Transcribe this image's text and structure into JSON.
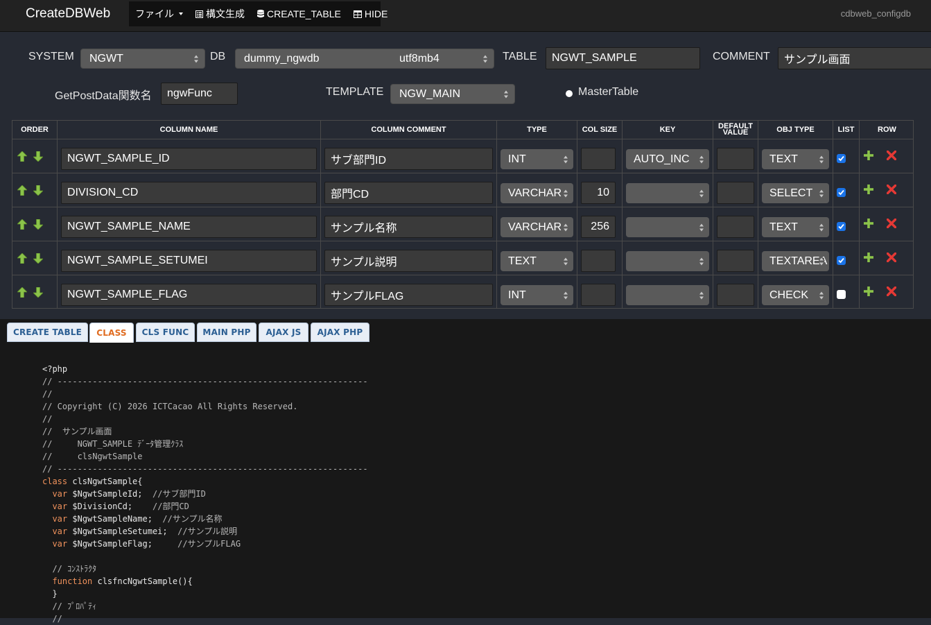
{
  "navbar": {
    "brand": "CreateDBWeb",
    "menu": {
      "file": "ファイル",
      "syntax": "構文生成",
      "create_table": "CREATE_TABLE",
      "hide": "HIDE"
    },
    "config_name": "cdbweb_configdb"
  },
  "form": {
    "system_label": "SYSTEM",
    "system_value": "NGWT",
    "db_label": "DB",
    "db_name": "dummy_ngwdb",
    "db_charset": "utf8mb4",
    "table_label": "TABLE",
    "table_value": "NGWT_SAMPLE",
    "comment_label": "COMMENT",
    "comment_value": "サンプル画面",
    "getpost_label": "GetPostData関数名",
    "getpost_value": "ngwFunc",
    "template_label": "TEMPLATE",
    "template_value": "NGW_MAIN",
    "master_table_label": "MasterTable"
  },
  "columns_table": {
    "headers": {
      "order": "ORDER",
      "column_name": "COLUMN NAME",
      "column_comment": "COLUMN COMMENT",
      "type": "TYPE",
      "col_size": "COL SIZE",
      "key": "KEY",
      "default_value_1": "DEFAULT",
      "default_value_2": "VALUE",
      "obj_type": "OBJ TYPE",
      "list": "LIST",
      "row": "ROW"
    },
    "rows": [
      {
        "name": "NGWT_SAMPLE_ID",
        "comment": "サブ部門ID",
        "type": "INT",
        "size": "",
        "key": "AUTO_INC",
        "default": "",
        "obj_type": "TEXT",
        "list": true
      },
      {
        "name": "DIVISION_CD",
        "comment": "部門CD",
        "type": "VARCHAR",
        "size": "10",
        "key": "",
        "default": "",
        "obj_type": "SELECT",
        "list": true
      },
      {
        "name": "NGWT_SAMPLE_NAME",
        "comment": "サンプル名称",
        "type": "VARCHAR",
        "size": "256",
        "key": "",
        "default": "",
        "obj_type": "TEXT",
        "list": true
      },
      {
        "name": "NGWT_SAMPLE_SETUMEI",
        "comment": "サンプル説明",
        "type": "TEXT",
        "size": "",
        "key": "",
        "default": "",
        "obj_type": "TEXTAREA",
        "list": true
      },
      {
        "name": "NGWT_SAMPLE_FLAG",
        "comment": "サンプルFLAG",
        "type": "INT",
        "size": "",
        "key": "",
        "default": "",
        "obj_type": "CHECK",
        "list": false
      }
    ]
  },
  "code_tabs": {
    "tabs": [
      "CREATE TABLE",
      "CLASS",
      "CLS FUNC",
      "MAIN PHP",
      "AJAX JS",
      "AJAX PHP"
    ],
    "active": "CLASS"
  },
  "code": {
    "lines": [
      "<?php",
      "// --------------------------------------------------------------",
      "//",
      "// Copyright (C) 2026 ICTCacao All Rights Reserved.",
      "//",
      "//  サンプル画面",
      "//     NGWT_SAMPLE ﾃﾞｰﾀ管理ｸﾗｽ",
      "//     clsNgwtSample",
      "// --------------------------------------------------------------",
      "class clsNgwtSample{",
      "  var $NgwtSampleId;  //サブ部門ID",
      "  var $DivisionCd;    //部門CD",
      "  var $NgwtSampleName;  //サンプル名称",
      "  var $NgwtSampleSetumei;  //サンプル説明",
      "  var $NgwtSampleFlag;     //サンプルFLAG",
      "",
      "  // ｺﾝｽﾄﾗｸﾀ",
      "  function clsfncNgwtSample(){",
      "  }",
      "  // ﾌﾟﾛﾊﾟﾃｨ",
      "  //"
    ]
  }
}
